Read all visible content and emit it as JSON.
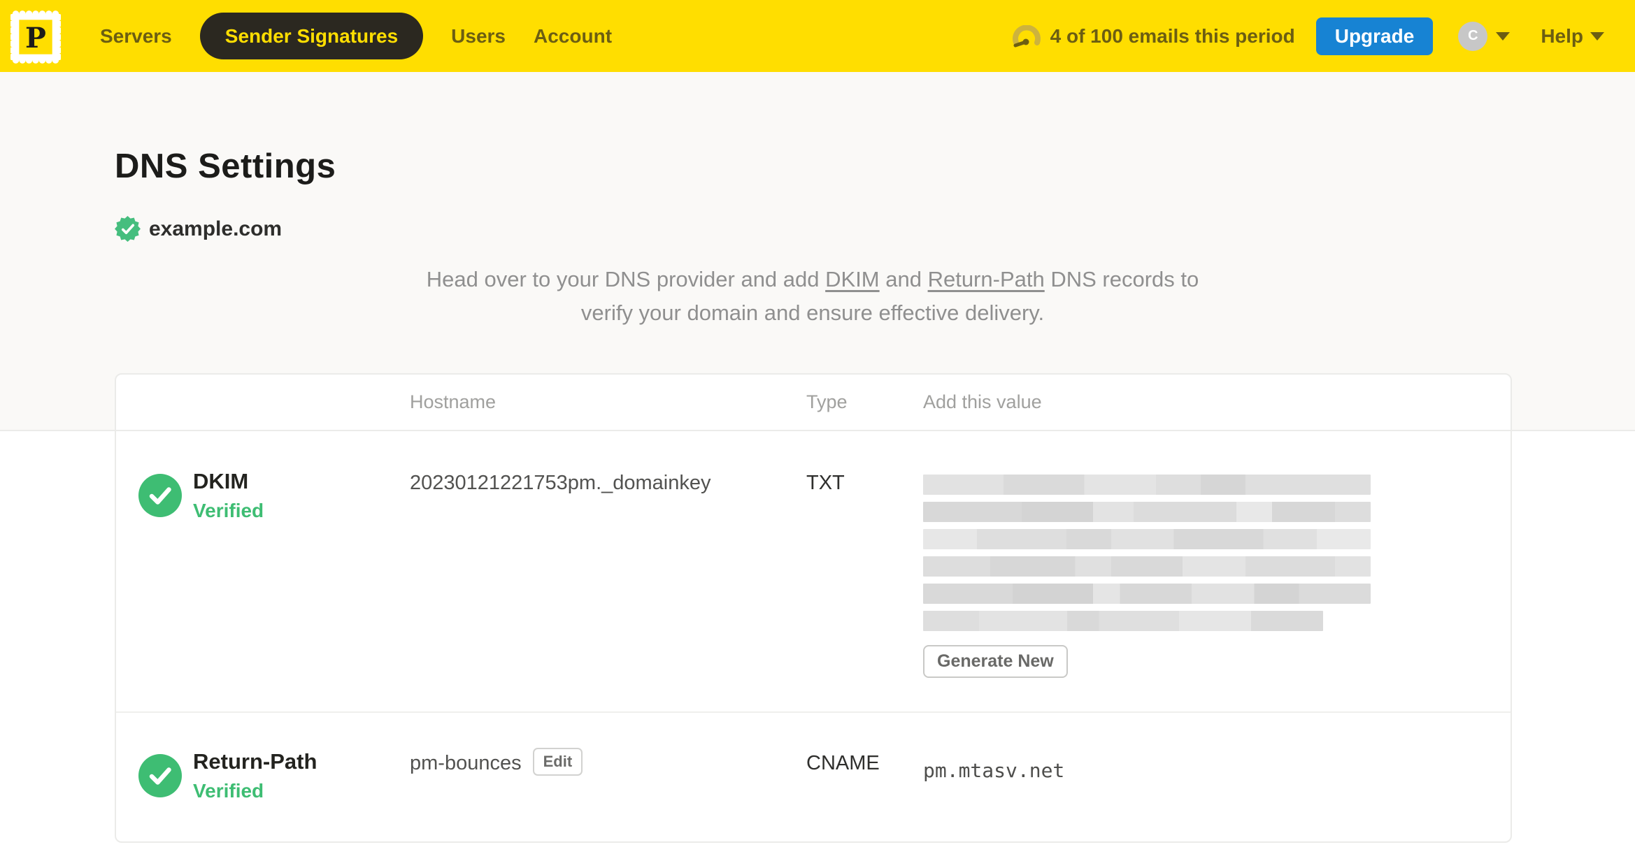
{
  "colors": {
    "brand_yellow": "#FFDE00",
    "nav_text": "#6C5E12",
    "active_pill_bg": "#2B2820",
    "upgrade_blue": "#1783D3",
    "success_green": "#3EBD73",
    "page_band_bg": "#FAF9F7"
  },
  "nav": {
    "logo_letter": "P",
    "items": [
      {
        "label": "Servers",
        "active": false
      },
      {
        "label": "Sender Signatures",
        "active": true
      },
      {
        "label": "Users",
        "active": false
      },
      {
        "label": "Account",
        "active": false
      }
    ],
    "usage_text": "4 of 100 emails this period",
    "upgrade_label": "Upgrade",
    "avatar_initial": "C",
    "help_label": "Help"
  },
  "page": {
    "title": "DNS Settings",
    "domain": "example.com",
    "domain_verified": true,
    "description": {
      "line1_pre": "Head over to your DNS provider and add ",
      "dkim_link": "DKIM",
      "line1_mid": " and ",
      "return_path_link": "Return-Path",
      "line1_post": " DNS records to",
      "line2": "verify your domain and ensure effective delivery."
    }
  },
  "table": {
    "headers": {
      "hostname": "Hostname",
      "type": "Type",
      "value": "Add this value"
    },
    "rows": [
      {
        "name": "DKIM",
        "status": "Verified",
        "hostname": "20230121221753pm._domainkey",
        "type": "TXT",
        "value_redacted": true,
        "action_label": "Generate New"
      },
      {
        "name": "Return-Path",
        "status": "Verified",
        "hostname": "pm-bounces",
        "edit_label": "Edit",
        "type": "CNAME",
        "value": "pm.mtasv.net"
      }
    ]
  }
}
